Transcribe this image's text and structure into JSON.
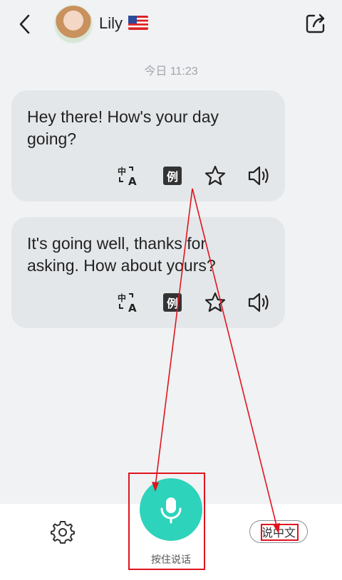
{
  "header": {
    "contact_name": "Lily",
    "flag_icon": "us-flag-icon"
  },
  "timestamp": "今日 11:23",
  "messages": [
    {
      "text": "Hey there! How's your day going?"
    },
    {
      "text": "It's going well, thanks for asking. How about yours?"
    }
  ],
  "actions": {
    "translate_icon": "translate-icon",
    "example_label": "例",
    "favorite_icon": "star-icon",
    "speaker_icon": "speaker-icon"
  },
  "bottom": {
    "mic_label": "按住说话",
    "lang_toggle": "说中文"
  },
  "colors": {
    "accent": "#2dd3ba",
    "annotation": "#e0141e"
  }
}
